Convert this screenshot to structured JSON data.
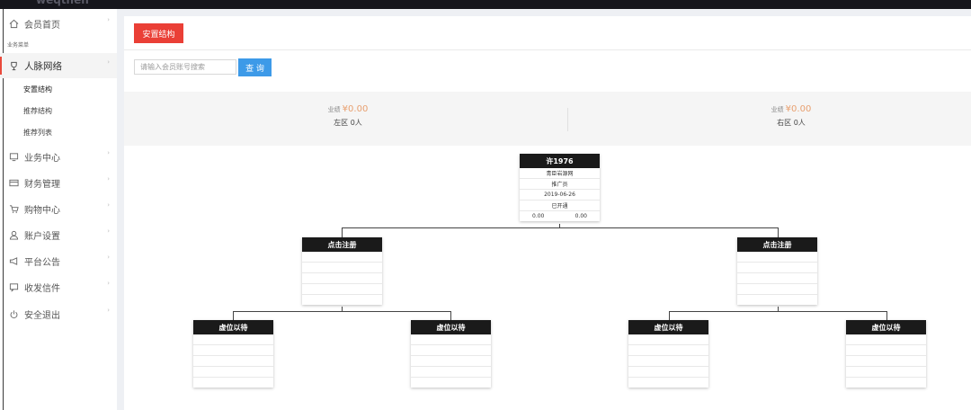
{
  "topbar": {
    "brand": "weqtnen"
  },
  "sidebar": {
    "items": [
      {
        "label": "会员首页",
        "icon": "home-icon"
      },
      {
        "label": "人脉网络",
        "icon": "trophy-icon"
      },
      {
        "label": "业务中心",
        "icon": "monitor-icon"
      },
      {
        "label": "财务管理",
        "icon": "card-icon"
      },
      {
        "label": "购物中心",
        "icon": "cart-icon"
      },
      {
        "label": "账户设置",
        "icon": "user-icon"
      },
      {
        "label": "平台公告",
        "icon": "megaphone-icon"
      },
      {
        "label": "收发信件",
        "icon": "message-icon"
      },
      {
        "label": "安全退出",
        "icon": "power-icon"
      }
    ],
    "group_label": "业务菜单",
    "sub_items": [
      "安置结构",
      "推荐结构",
      "推荐列表"
    ]
  },
  "toolbar": {
    "tab_label": "安置结构"
  },
  "search": {
    "placeholder": "请输入会员账号搜索",
    "button_label": "查 询"
  },
  "stats": {
    "left": {
      "label": "业绩",
      "value": "¥0.00",
      "zone": "左区 0人"
    },
    "right": {
      "label": "业绩",
      "value": "¥0.00",
      "zone": "右区 0人"
    }
  },
  "tree": {
    "root": {
      "name": "许1976",
      "rows": [
        "青臣岩源网",
        "推广员",
        "2019-06-26",
        "已开通"
      ],
      "left_value": "0.00",
      "right_value": "0.00"
    },
    "level2": {
      "title": "点击注册"
    },
    "level3": {
      "title": "虚位以待"
    }
  }
}
